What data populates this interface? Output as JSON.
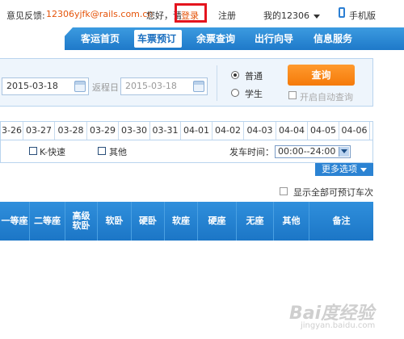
{
  "topbar": {
    "feedback_label": "意见反馈:",
    "feedback_email": "12306yjfk@rails.com.cn",
    "greeting": "您好，请",
    "login": "登录",
    "register": "注册",
    "my12306": "我的12306",
    "mobile": "手机版"
  },
  "nav": {
    "items": [
      "客运首页",
      "车票预订",
      "余票查询",
      "出行向导",
      "信息服务"
    ],
    "active": "车票预订"
  },
  "search": {
    "depart_date": "2015-03-18",
    "return_label": "返程日",
    "return_date": "2015-03-18",
    "ticket_type_normal": "普通",
    "ticket_type_student": "学生",
    "query_button": "查询",
    "auto_query_label": "开启自动查询"
  },
  "date_strip": [
    "3-26",
    "03-27",
    "03-28",
    "03-29",
    "03-30",
    "03-31",
    "04-01",
    "04-02",
    "04-03",
    "04-04",
    "04-05",
    "04-06"
  ],
  "filters": {
    "k_fast": "K-快速",
    "other": "其他",
    "depart_time_label": "发车时间：",
    "depart_time_value": "00:00--24:00",
    "more_options": "更多选项"
  },
  "show_all_label": "显示全部可预订车次",
  "table_headers": [
    "一等座",
    "二等座",
    "高级软卧",
    "软卧",
    "硬卧",
    "软座",
    "硬座",
    "无座",
    "其他",
    "备注"
  ],
  "watermark": {
    "text": "Bai度经验",
    "sub": "jingyan.baidu.com"
  }
}
